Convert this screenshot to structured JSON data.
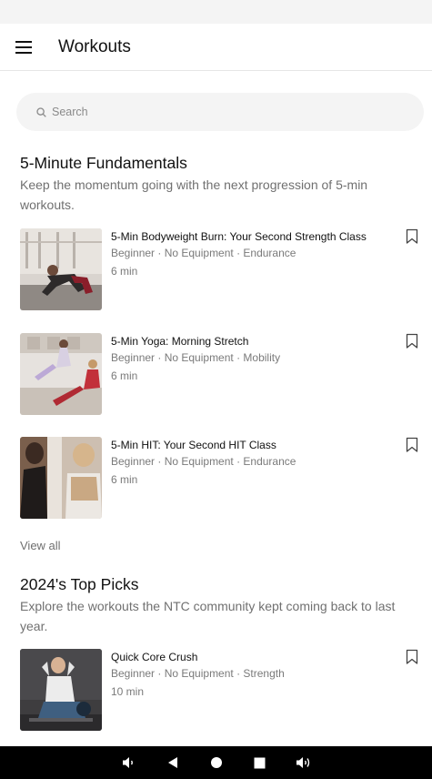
{
  "header": {
    "title": "Workouts"
  },
  "search": {
    "placeholder": "Search"
  },
  "sections": [
    {
      "title": "5-Minute Fundamentals",
      "description": "Keep the momentum going with the next progression of 5-min workouts.",
      "items": [
        {
          "title": "5-Min Bodyweight Burn: Your Second Strength Class",
          "meta": "Beginner · No Equipment · Endurance",
          "duration": "6 min"
        },
        {
          "title": "5-Min Yoga: Morning Stretch",
          "meta": "Beginner · No Equipment · Mobility",
          "duration": "6 min"
        },
        {
          "title": "5-Min HIT: Your Second HIT Class",
          "meta": "Beginner · No Equipment · Endurance",
          "duration": "6 min"
        }
      ],
      "view_all": "View all"
    },
    {
      "title": "2024's Top Picks",
      "description": "Explore the workouts the NTC community kept coming back to last year.",
      "items": [
        {
          "title": "Quick Core Crush",
          "meta": "Beginner · No Equipment · Strength",
          "duration": "10 min"
        }
      ]
    }
  ],
  "icons": {
    "menu": "hamburger-menu-icon",
    "search": "search-icon",
    "bookmark": "bookmark-icon",
    "nav": [
      "volume-down-icon",
      "back-icon",
      "home-icon",
      "recents-icon",
      "volume-up-icon"
    ]
  },
  "colors": {
    "text": "#111111",
    "secondary": "#707070",
    "search_bg": "#f4f4f4",
    "nav_bar": "#000000"
  }
}
